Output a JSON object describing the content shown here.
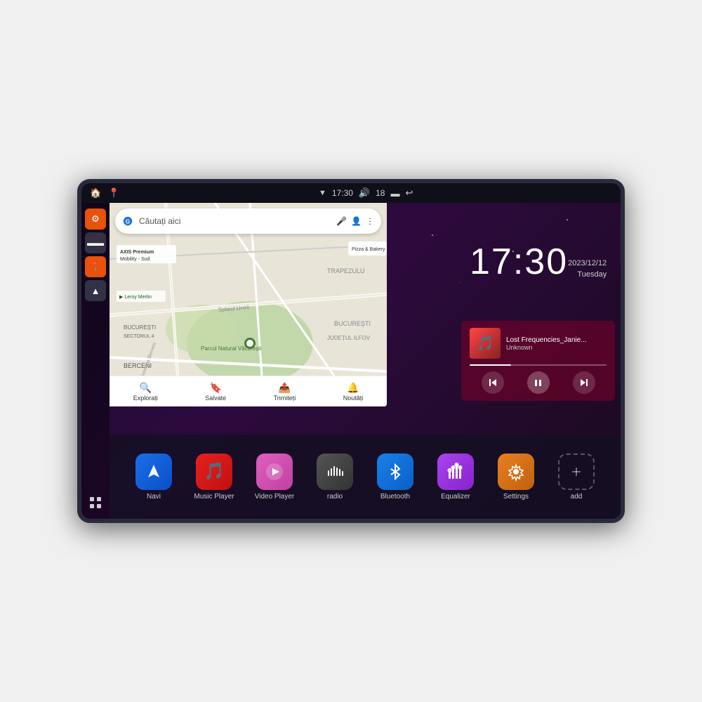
{
  "device": {
    "statusBar": {
      "leftIcons": [
        "🏠",
        "📍"
      ],
      "time": "17:30",
      "rightIcons": [
        "🔊",
        "18",
        "🔋",
        "↩"
      ]
    }
  },
  "clock": {
    "time": "17:30",
    "date": "2023/12/12",
    "day": "Tuesday"
  },
  "music": {
    "trackTitle": "Lost Frequencies_Janie...",
    "artist": "Unknown",
    "albumArt": "🎵"
  },
  "maps": {
    "searchPlaceholder": "Căutați aici",
    "bottomNav": [
      {
        "label": "Explorați",
        "icon": "🔍"
      },
      {
        "label": "Salvate",
        "icon": "🔖"
      },
      {
        "label": "Trimiteți",
        "icon": "📤"
      },
      {
        "label": "Noutăți",
        "icon": "🔔"
      }
    ]
  },
  "apps": [
    {
      "id": "navi",
      "label": "Navi",
      "iconClass": "blue-nav",
      "icon": "▲"
    },
    {
      "id": "music-player",
      "label": "Music Player",
      "iconClass": "red-music",
      "icon": "🎵"
    },
    {
      "id": "video-player",
      "label": "Video Player",
      "iconClass": "pink-video",
      "icon": "▶"
    },
    {
      "id": "radio",
      "label": "radio",
      "iconClass": "gray-radio",
      "icon": "📻"
    },
    {
      "id": "bluetooth",
      "label": "Bluetooth",
      "iconClass": "blue-bt",
      "icon": "⚡"
    },
    {
      "id": "equalizer",
      "label": "Equalizer",
      "iconClass": "purple-eq",
      "icon": "🎚"
    },
    {
      "id": "settings",
      "label": "Settings",
      "iconClass": "orange-set",
      "icon": "⚙"
    },
    {
      "id": "add",
      "label": "add",
      "iconClass": "dashed-add",
      "icon": "+"
    }
  ],
  "sidebar": {
    "icons": [
      {
        "id": "settings",
        "iconClass": "orange",
        "icon": "⚙"
      },
      {
        "id": "folder",
        "iconClass": "dark",
        "icon": "📁"
      },
      {
        "id": "map",
        "iconClass": "orange",
        "icon": "📍"
      },
      {
        "id": "nav",
        "iconClass": "dark",
        "icon": "▲"
      }
    ]
  },
  "colors": {
    "accent": "#e8520a",
    "background": "#1a0a2e",
    "musicBg": "rgba(120,0,40,0.6)"
  }
}
